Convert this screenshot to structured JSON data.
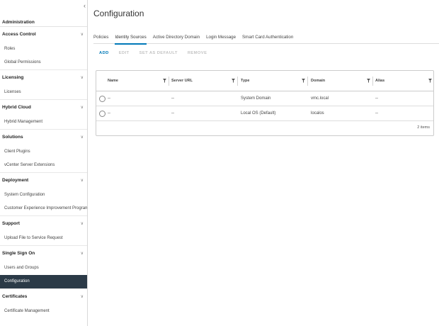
{
  "sidebar": {
    "header": "Administration",
    "sections": [
      {
        "title": "Access Control",
        "items": [
          "Roles",
          "Global Permissions"
        ]
      },
      {
        "title": "Licensing",
        "items": [
          "Licenses"
        ]
      },
      {
        "title": "Hybrid Cloud",
        "items": [
          "Hybrid Management"
        ]
      },
      {
        "title": "Solutions",
        "items": [
          "Client Plugins",
          "vCenter Server Extensions"
        ]
      },
      {
        "title": "Deployment",
        "items": [
          "System Configuration",
          "Customer Experience Improvement Program"
        ]
      },
      {
        "title": "Support",
        "items": [
          "Upload File to Service Request"
        ]
      },
      {
        "title": "Single Sign On",
        "items": [
          "Users and Groups",
          "Configuration"
        ]
      },
      {
        "title": "Certificates",
        "items": [
          "Certificate Management"
        ]
      }
    ],
    "active_item": "Configuration"
  },
  "main": {
    "title": "Configuration",
    "tabs": [
      "Policies",
      "Identity Sources",
      "Active Directory Domain",
      "Login Message",
      "Smart Card Authentication"
    ],
    "active_tab": "Identity Sources",
    "actions": [
      {
        "label": "ADD",
        "enabled": true
      },
      {
        "label": "EDIT",
        "enabled": false
      },
      {
        "label": "SET AS DEFAULT",
        "enabled": false
      },
      {
        "label": "REMOVE",
        "enabled": false
      }
    ],
    "grid": {
      "columns": [
        "Name",
        "Server URL",
        "Type",
        "Domain",
        "Alias"
      ],
      "rows": [
        {
          "name": "--",
          "server_url": "--",
          "type": "System Domain",
          "domain": "vmc.local",
          "alias": "--"
        },
        {
          "name": "--",
          "server_url": "--",
          "type": "Local OS (Default)",
          "domain": "localos",
          "alias": "--"
        }
      ],
      "footer": "2 items"
    }
  },
  "colors": {
    "accent": "#0079b8",
    "active_nav_bg": "#2b3a47"
  }
}
